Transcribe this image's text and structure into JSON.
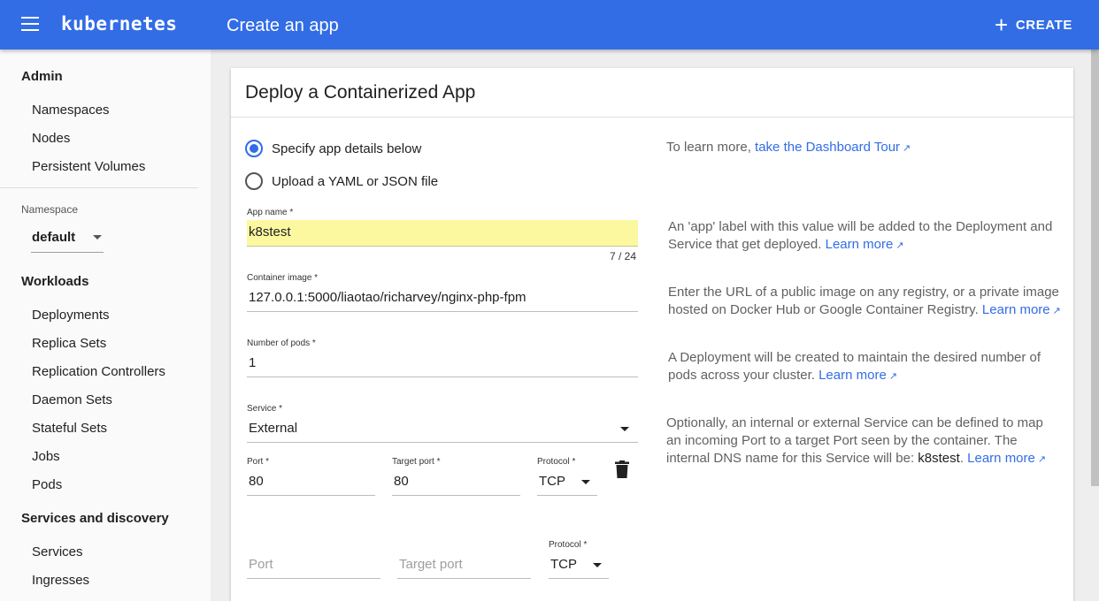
{
  "topbar": {
    "brand": "kubernetes",
    "title": "Create an app",
    "create_label": "CREATE",
    "color": "#326de6"
  },
  "sidebar": {
    "admin_title": "Admin",
    "admin_items": [
      "Namespaces",
      "Nodes",
      "Persistent Volumes"
    ],
    "namespace_label": "Namespace",
    "namespace_value": "default",
    "workloads_title": "Workloads",
    "workload_items": [
      "Deployments",
      "Replica Sets",
      "Replication Controllers",
      "Daemon Sets",
      "Stateful Sets",
      "Jobs",
      "Pods"
    ],
    "services_title": "Services and discovery",
    "services_items": [
      "Services",
      "Ingresses"
    ]
  },
  "card": {
    "title": "Deploy a Containerized App",
    "radio_options": [
      "Specify app details below",
      "Upload a YAML or JSON file"
    ],
    "selected_radio": 0,
    "tour_prefix": "To learn more,",
    "tour_link": "take the Dashboard Tour",
    "app_name": {
      "label": "App name *",
      "value": "k8stest",
      "counter": "7 / 24"
    },
    "container_image": {
      "label": "Container image *",
      "value": "127.0.0.1:5000/liaotao/richarvey/nginx-php-fpm"
    },
    "pods": {
      "label": "Number of pods *",
      "value": "1"
    },
    "service": {
      "label": "Service *",
      "value": "External"
    },
    "port_row_1": {
      "port_label": "Port *",
      "port_value": "80",
      "target_label": "Target port *",
      "target_value": "80",
      "protocol_label": "Protocol *",
      "protocol_value": "TCP"
    },
    "port_row_2": {
      "port_placeholder": "Port",
      "target_placeholder": "Target port",
      "protocol_label": "Protocol *",
      "protocol_value": "TCP"
    },
    "help": {
      "app_name": "An 'app' label with this value will be added to the Deployment and Service that get deployed.",
      "image": "Enter the URL of a public image on any registry, or a private image hosted on Docker Hub or Google Container Registry.",
      "pods": "A Deployment will be created to maintain the desired number of pods across your cluster.",
      "service": "Optionally, an internal or external Service can be defined to map an incoming Port to a target Port seen by the container. The internal DNS name for this Service will be:",
      "service_dns": "k8stest",
      "learn_more": "Learn more"
    }
  },
  "icons": {
    "menu": "menu-icon",
    "add": "add-icon",
    "delete": "delete-icon",
    "external": "open-in-new-icon"
  }
}
